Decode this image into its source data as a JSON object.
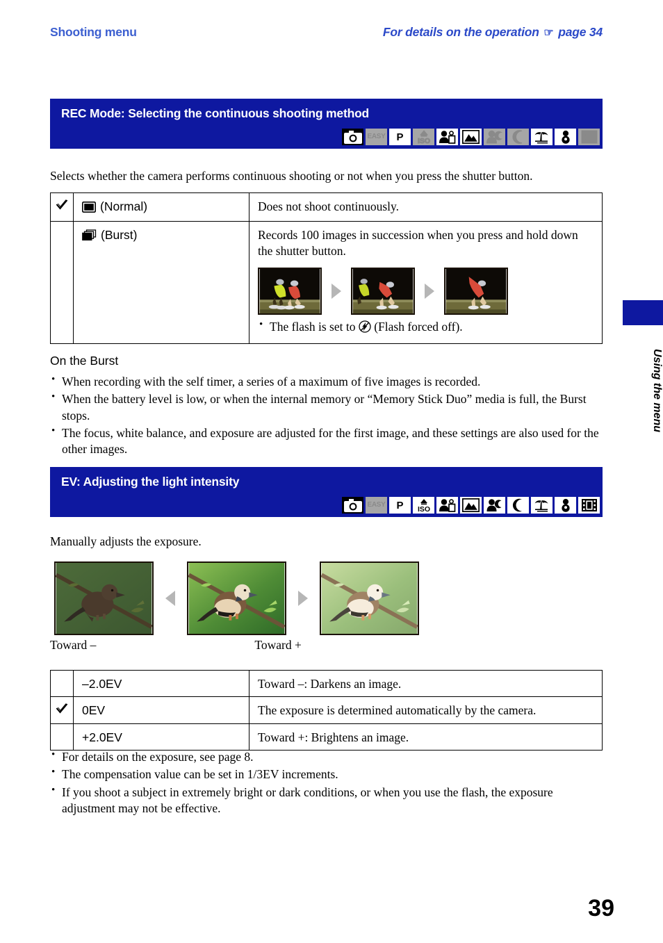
{
  "running_head": {
    "left": "Shooting menu",
    "right_prefix": "For details on the operation",
    "hand_icon": "pointing-hand-icon",
    "right_suffix": "page 34"
  },
  "colors": {
    "section_blue": "#0e18a0",
    "head_blue": "#2b49c8",
    "mode_dim_bg": "#a6a6a6"
  },
  "section_rec": {
    "title": "REC Mode: Selecting the continuous shooting method",
    "intro": "Selects whether the camera performs continuous shooting or not when you press the shutter button.",
    "modes": [
      {
        "name": "camera-auto-icon",
        "label": "",
        "active": true
      },
      {
        "name": "easy-shooting-icon",
        "label": "EASY",
        "active": false
      },
      {
        "name": "program-mode-icon",
        "label": "P",
        "active": true
      },
      {
        "name": "iso-high-sensitivity-icon",
        "label": "ISO",
        "active": false
      },
      {
        "name": "soft-snap-icon",
        "label": "",
        "active": true
      },
      {
        "name": "landscape-icon",
        "label": "",
        "active": true
      },
      {
        "name": "twilight-portrait-icon",
        "label": "",
        "active": false
      },
      {
        "name": "twilight-icon",
        "label": "",
        "active": false
      },
      {
        "name": "beach-icon",
        "label": "",
        "active": true
      },
      {
        "name": "snow-icon",
        "label": "",
        "active": true
      },
      {
        "name": "movie-icon",
        "label": "",
        "active": false
      }
    ],
    "table": {
      "rows": [
        {
          "checked": true,
          "icon": "normal-single-frame-icon",
          "option": "(Normal)",
          "description": "Does not shoot continuously."
        },
        {
          "checked": false,
          "icon": "burst-stacked-frames-icon",
          "option": "(Burst)",
          "description": "Records 100 images in succession when you press and hold down the shutter button.",
          "photos": [
            "skater-burst-frame-1",
            "skater-burst-frame-2",
            "skater-burst-frame-3"
          ],
          "note_prefix": "The flash is set to",
          "note_icon": "flash-forced-off-icon",
          "note_suffix": "(Flash forced off)."
        }
      ]
    },
    "subhead": "On the Burst",
    "bullets": [
      "When recording with the self timer, a series of a maximum of five images is recorded.",
      "When the battery level is low, or when the internal memory or “Memory Stick Duo” media is full, the Burst stops.",
      "The focus, white balance, and exposure are adjusted for the first image, and these settings are also used for the other images."
    ]
  },
  "section_ev": {
    "title": "EV: Adjusting the light intensity",
    "intro": "Manually adjusts the exposure.",
    "modes": [
      {
        "name": "camera-auto-icon",
        "label": "",
        "active": true
      },
      {
        "name": "easy-shooting-icon",
        "label": "EASY",
        "active": false
      },
      {
        "name": "program-mode-icon",
        "label": "P",
        "active": true
      },
      {
        "name": "iso-high-sensitivity-icon",
        "label": "ISO",
        "active": true
      },
      {
        "name": "soft-snap-icon",
        "label": "",
        "active": true
      },
      {
        "name": "landscape-icon",
        "label": "",
        "active": true
      },
      {
        "name": "twilight-portrait-icon",
        "label": "",
        "active": true
      },
      {
        "name": "twilight-icon",
        "label": "",
        "active": true
      },
      {
        "name": "beach-icon",
        "label": "",
        "active": true
      },
      {
        "name": "snow-icon",
        "label": "",
        "active": true
      },
      {
        "name": "movie-icon",
        "label": "",
        "active": true
      }
    ],
    "photos": [
      "bird-darkened",
      "bird-normal",
      "bird-brightened"
    ],
    "caption_left": "Toward –",
    "caption_right": "Toward +",
    "table": {
      "rows": [
        {
          "checked": false,
          "value": "–2.0EV",
          "description": "Toward –: Darkens an image."
        },
        {
          "checked": true,
          "value": "0EV",
          "description": "The exposure is determined automatically by the camera."
        },
        {
          "checked": false,
          "value": "+2.0EV",
          "description": "Toward +: Brightens an image."
        }
      ]
    },
    "bullets": [
      "For details on the exposure, see page 8.",
      "The compensation value can be set in 1/3EV increments.",
      "If you shoot a subject in extremely bright or dark conditions, or when you use the flash, the exposure adjustment may not be effective."
    ]
  },
  "side_tab": {
    "label": "Using the menu"
  },
  "folio": "39"
}
